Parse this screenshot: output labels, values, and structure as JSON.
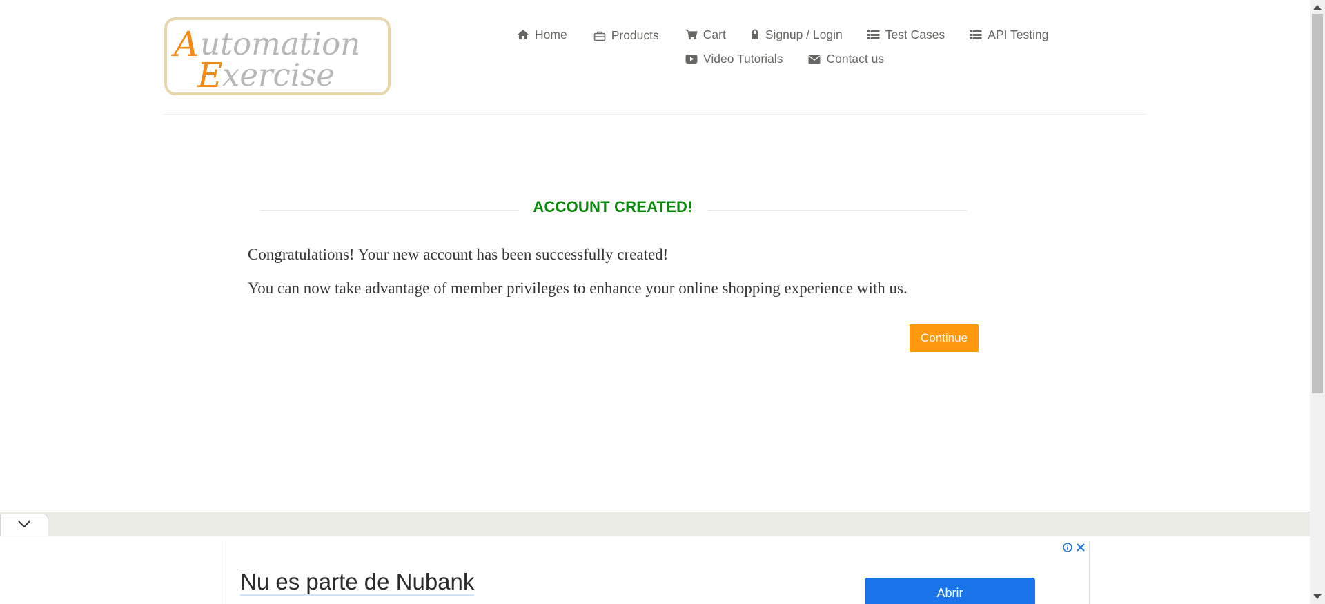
{
  "header": {
    "logo": {
      "line1": "Automation",
      "line2": "Exercise"
    },
    "nav": [
      {
        "label": "Home",
        "icon": "home-icon"
      },
      {
        "label": "Products",
        "icon": "briefcase-icon"
      },
      {
        "label": "Cart",
        "icon": "shopping-cart-icon"
      },
      {
        "label": "Signup / Login",
        "icon": "lock-icon"
      },
      {
        "label": "Test Cases",
        "icon": "list-icon"
      },
      {
        "label": "API Testing",
        "icon": "list-icon"
      },
      {
        "label": "Video Tutorials",
        "icon": "youtube-play-icon"
      },
      {
        "label": "Contact us",
        "icon": "envelope-icon"
      }
    ]
  },
  "main": {
    "title": "ACCOUNT CREATED!",
    "message1": "Congratulations! Your new account has been successfully created!",
    "message2": "You can now take advantage of member privileges to enhance your online shopping experience with us.",
    "continue_label": "Continue"
  },
  "ad": {
    "headline": "Nu es parte de Nubank",
    "button_label": "Abrir",
    "icons": [
      "chevron-down-icon",
      "info-icon",
      "close-icon"
    ]
  },
  "colors": {
    "title_green": "#0a8a0a",
    "accent_orange": "#fe980f",
    "nav_text": "#696763",
    "ad_button_blue": "#1a73e8"
  }
}
